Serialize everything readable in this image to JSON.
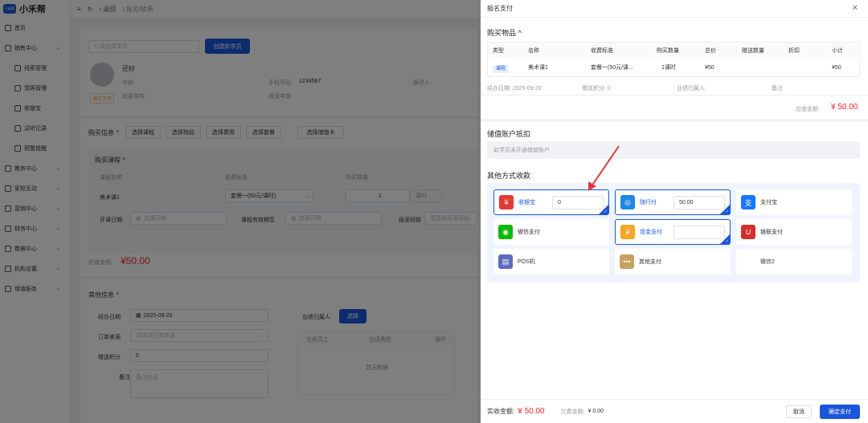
{
  "app": {
    "logo_badge": "小禾帮",
    "name": "小禾帮"
  },
  "sidebar": {
    "items": [
      {
        "label": "首页",
        "icon": "chart-icon"
      },
      {
        "label": "销售中心",
        "icon": "sales-icon",
        "chevron": "⌄"
      },
      {
        "label": "线索管理",
        "icon": "clue-icon"
      },
      {
        "label": "潜客管理",
        "icon": "user-icon"
      },
      {
        "label": "收银宝",
        "icon": "cash-icon"
      },
      {
        "label": "试听记录",
        "icon": "record-icon"
      },
      {
        "label": "预警提醒",
        "icon": "bell-icon"
      },
      {
        "label": "教务中心",
        "icon": "edu-icon",
        "chevron": "⌄"
      },
      {
        "label": "家校互动",
        "icon": "home-icon",
        "chevron": "⌄"
      },
      {
        "label": "营销中心",
        "icon": "marketing-icon",
        "chevron": "⌄"
      },
      {
        "label": "财务中心",
        "icon": "finance-icon",
        "chevron": "⌄"
      },
      {
        "label": "数据中心",
        "icon": "data-icon",
        "chevron": "⌄"
      },
      {
        "label": "机构设置",
        "icon": "settings-icon",
        "chevron": "⌄"
      },
      {
        "label": "增值服务",
        "icon": "star-icon",
        "chevron": "⌄"
      }
    ]
  },
  "topbar": {
    "menu": "≡",
    "refresh": "↻",
    "back": "‹ 返回",
    "breadcrumb": "| 报名/续费"
  },
  "student": {
    "search_placeholder": "请选择学员",
    "create_btn": "创建新学员",
    "name": "还好",
    "status": "潜在学员",
    "age_label": "年龄:",
    "phone_label": "手机号码:",
    "phone": "1234567",
    "followup_label": "跟进人:",
    "school_label": "就读学校:",
    "grade_label": "就读年级:"
  },
  "buy": {
    "title": "购买信息 ^",
    "buttons": [
      "选择课程",
      "选择物品",
      "选择费用",
      "选择套餐",
      "选择储值卡"
    ],
    "course_title": "购买课程 ^",
    "cols": [
      "课程名称",
      "收费标准",
      "购买数量"
    ],
    "course_name": "美术课1",
    "standard": "套餐一(50元/课时)",
    "qty": "1",
    "unit": "课时",
    "start_label": "开课日期",
    "start_ph": "选择日期",
    "valid_label": "课程有效期至",
    "valid_ph": "选择日期",
    "class_label": "报读班级",
    "class_ph": "请选择报读班级",
    "total_label": "应收金额:",
    "total": "¥50.00"
  },
  "other": {
    "title": "其他信息 ^",
    "date_label": "经办日期",
    "date": "2025-09-20",
    "source_label": "订单来源",
    "source_ph": "请选择订单来源",
    "points_label": "赠送积分",
    "points": "0",
    "remark_label": "备注",
    "remark_ph": "备注信息",
    "perf_label": "业绩归属人:",
    "perf_btn": "选择",
    "perf_cols": [
      "业绩员工",
      "业绩角色",
      "操作"
    ],
    "perf_empty": "暂无数据"
  },
  "drawer": {
    "title": "报名支付",
    "close": "✕",
    "goods_title": "购买物品 ^",
    "cols": [
      "类型",
      "名称",
      "收费标准",
      "购买数量",
      "总价",
      "赠送数量",
      "折扣",
      "小计"
    ],
    "row": {
      "type": "课程",
      "name": "美术课1",
      "standard": "套餐一(50元/课...",
      "qty": "1课时",
      "total": "¥50",
      "gift": "",
      "discount": "",
      "subtotal": "¥50"
    },
    "date_label": "经办日期: 2025-09-20",
    "points_label": "赠送积分: 0",
    "perf_label": "业绩归属人:",
    "remark_label": "备注:",
    "due_label": "应收金额:",
    "due": "¥ 50.00",
    "stored_title": "储值账户抵扣",
    "stored_msg": "此学员未开通储值账户",
    "pay_title": "其他方式收款",
    "methods": [
      {
        "label": "收银宝",
        "amount": "0",
        "icon": "cashier-icon",
        "color": "#e53935",
        "glyph": "¥"
      },
      {
        "label": "随行付",
        "amount": "50.00",
        "icon": "suixingfu-icon",
        "color": "#1e88e5",
        "glyph": "◎"
      },
      {
        "label": "支付宝",
        "icon": "alipay-icon",
        "color": "#1677ff",
        "glyph": "支"
      },
      {
        "label": "微信支付",
        "icon": "wechat-icon",
        "color": "#09bb07",
        "glyph": "◉"
      },
      {
        "label": "现金支付",
        "amount": "",
        "icon": "cash-icon",
        "color": "#f5a623",
        "glyph": "¥"
      },
      {
        "label": "银联支付",
        "icon": "unionpay-icon",
        "color": "#d32f2f",
        "glyph": "U"
      },
      {
        "label": "POS机",
        "icon": "pos-icon",
        "color": "#5c6bc0",
        "glyph": "▤"
      },
      {
        "label": "其他支付",
        "icon": "more-icon",
        "color": "#c8a060",
        "glyph": "•••"
      },
      {
        "label": "微信2",
        "icon": "",
        "color": "#fff",
        "glyph": ""
      }
    ],
    "footer": {
      "paid_label": "实收金额:",
      "paid": "¥ 50.00",
      "owe_label": "欠费金额:",
      "owe": "¥ 0.00",
      "cancel": "取消",
      "confirm": "确定支付"
    }
  }
}
